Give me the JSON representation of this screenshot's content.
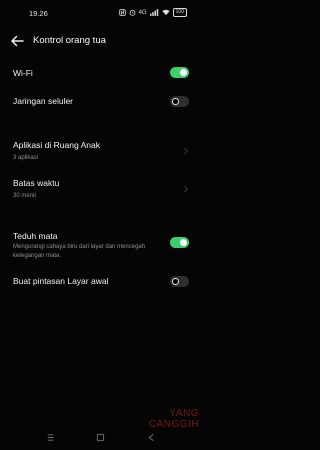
{
  "status_bar": {
    "time": "19.26",
    "battery": "100",
    "signal_text": "4G"
  },
  "header": {
    "title": "Kontrol orang tua"
  },
  "settings": {
    "wifi": {
      "label": "Wi-Fi",
      "state": "on"
    },
    "cellular": {
      "label": "Jaringan seluler",
      "state": "off"
    },
    "kids_apps": {
      "label": "Aplikasi di Ruang Anak",
      "sub": "3 aplikasi"
    },
    "time_limit": {
      "label": "Batas waktu",
      "sub": "30 menit"
    },
    "eye_comfort": {
      "label": "Teduh mata",
      "sub": "Mengurangi cahaya biru dari layar dan mencegah ketegangan mata.",
      "state": "on"
    },
    "shortcut": {
      "label": "Buat pintasan Layar awal",
      "state": "off"
    }
  },
  "watermark": {
    "line1": "YANG",
    "line2": "CANGGIH"
  },
  "colors": {
    "accent": "#3ccf6b",
    "background": "#050505"
  }
}
